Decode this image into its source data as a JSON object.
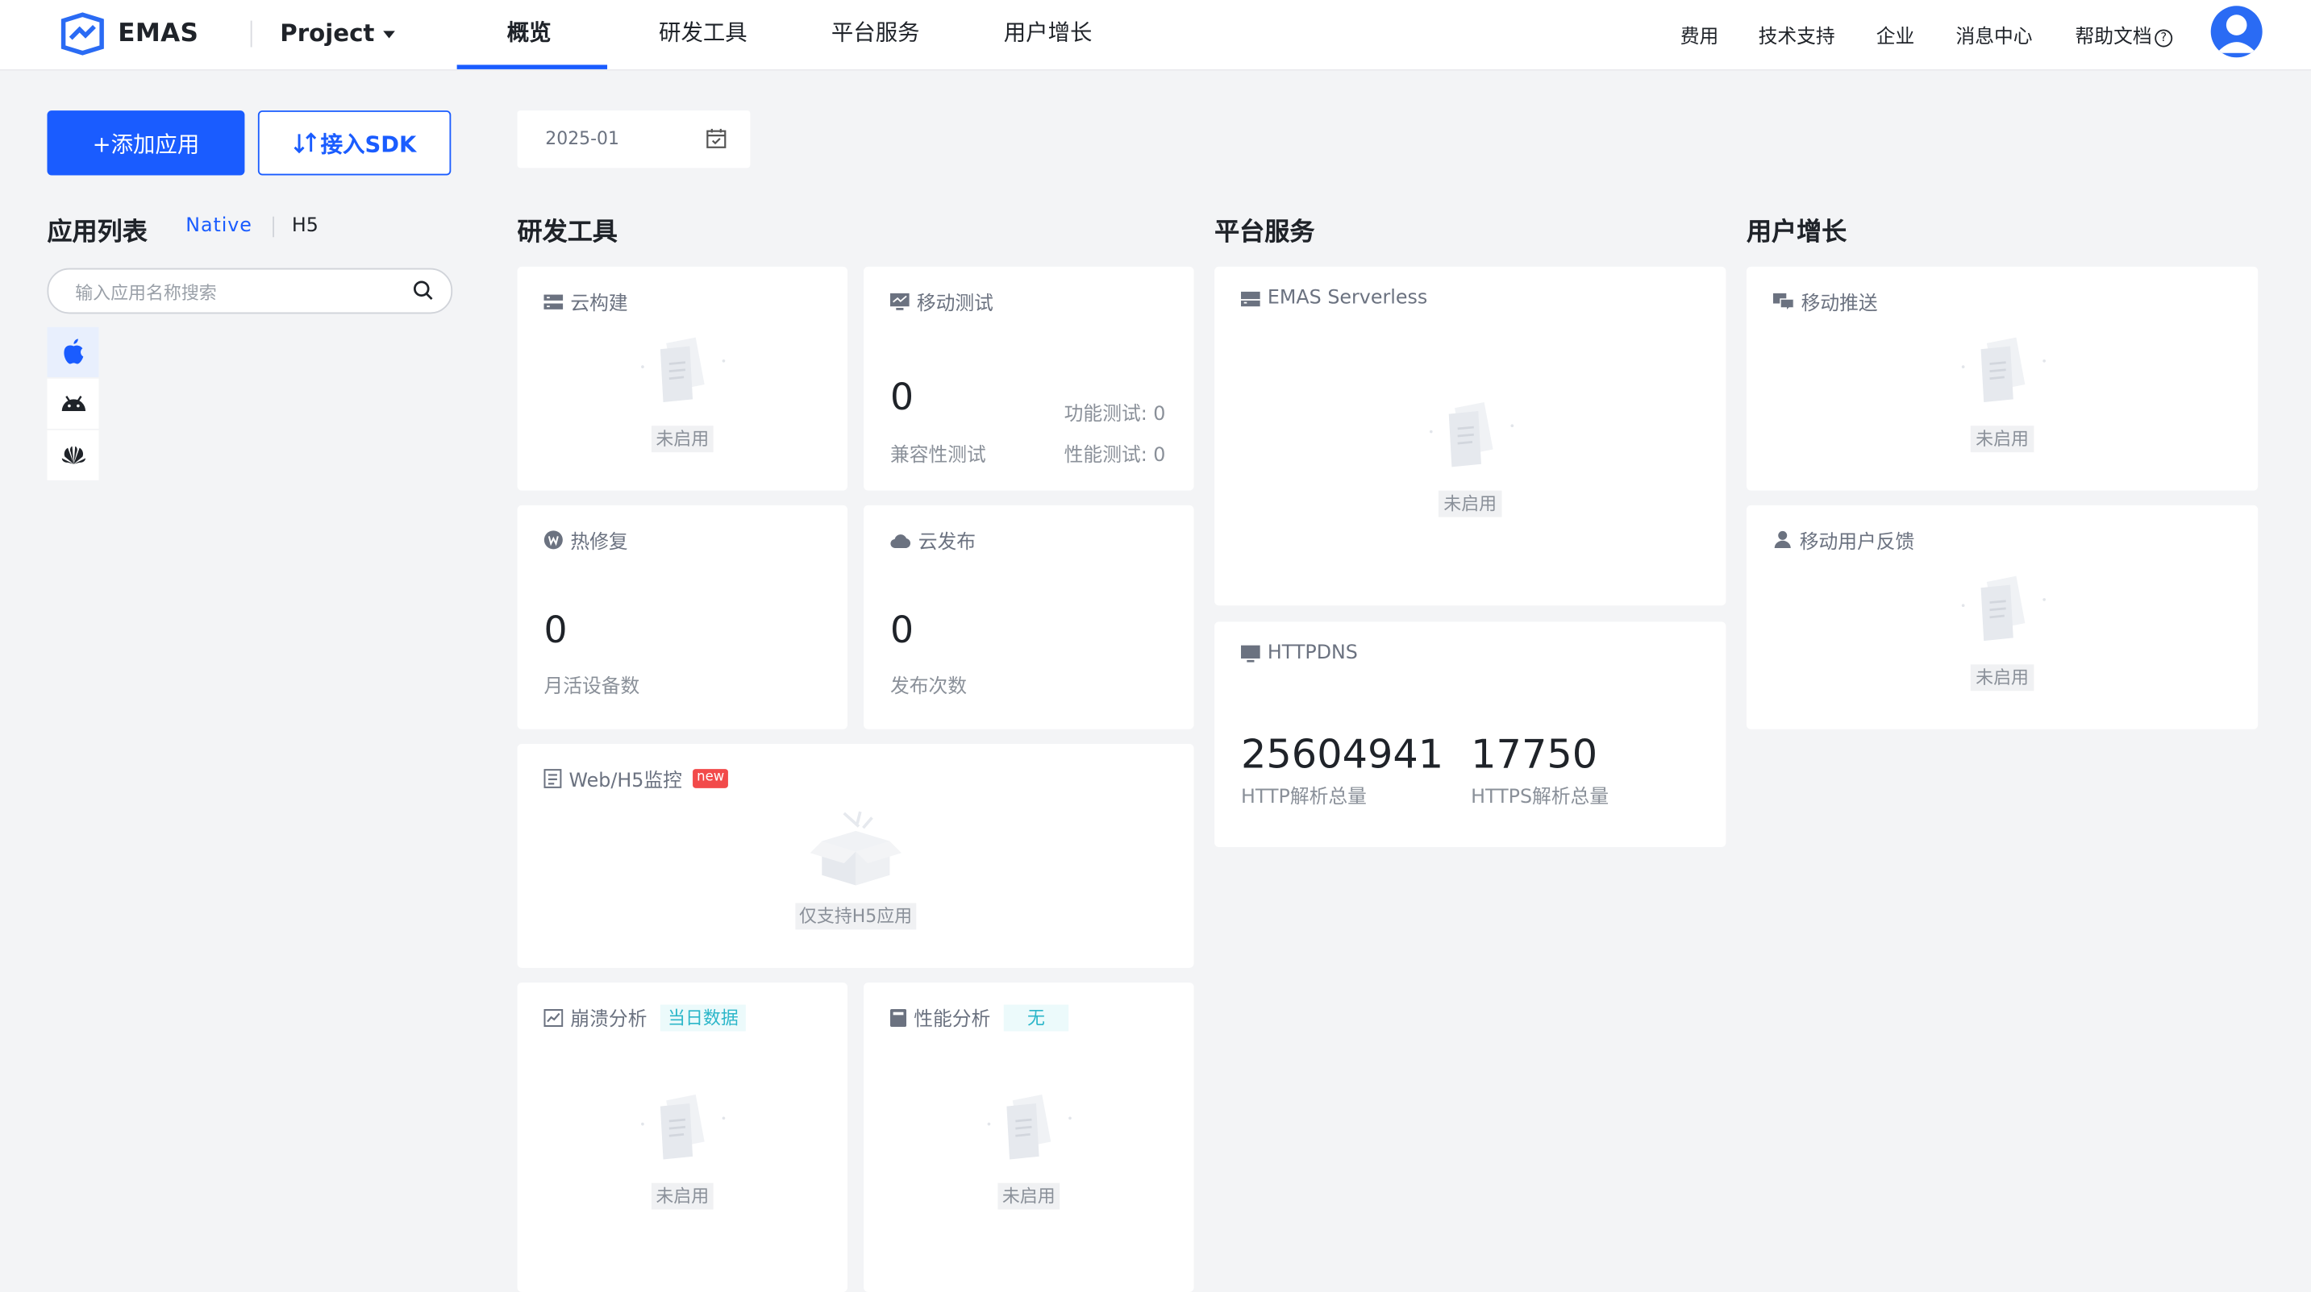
{
  "header": {
    "brand": "EMAS",
    "project_label": "Project",
    "nav_tabs": [
      "概览",
      "研发工具",
      "平台服务",
      "用户增长"
    ],
    "right_links": [
      "费用",
      "技术支持",
      "企业",
      "消息中心",
      "帮助文档"
    ],
    "help_icon": "?"
  },
  "sidebar": {
    "add_app_label": "+添加应用",
    "sdk_label": "接入SDK",
    "list_title": "应用列表",
    "segment_native": "Native",
    "segment_h5": "H5",
    "search_placeholder": "输入应用名称搜索",
    "platforms": [
      "apple-icon",
      "android-icon",
      "huawei-icon"
    ]
  },
  "date_picker": {
    "value": "2025-01"
  },
  "sections": {
    "dev_tools": "研发工具",
    "platform": "平台服务",
    "growth": "用户增长"
  },
  "cards": {
    "cloud_build": {
      "title": "云构建",
      "status": "未启用"
    },
    "mobile_test": {
      "title": "移动测试",
      "value": "0",
      "label": "兼容性测试",
      "func_test": "功能测试: 0",
      "perf_test": "性能测试: 0"
    },
    "hotfix": {
      "title": "热修复",
      "value": "0",
      "label": "月活设备数"
    },
    "cloud_release": {
      "title": "云发布",
      "value": "0",
      "label": "发布次数"
    },
    "web_monitor": {
      "title": "Web/H5监控",
      "badge": "new",
      "status": "仅支持H5应用"
    },
    "crash": {
      "title": "崩溃分析",
      "badge": "当日数据",
      "status": "未启用"
    },
    "perf": {
      "title": "性能分析",
      "badge": "无",
      "status": "未启用"
    },
    "serverless": {
      "title": "EMAS Serverless",
      "status": "未启用"
    },
    "httpdns": {
      "title": "HTTPDNS",
      "http_value": "25604941",
      "http_label": "HTTP解析总量",
      "https_value": "17750",
      "https_label": "HTTPS解析总量"
    },
    "push": {
      "title": "移动推送",
      "status": "未启用"
    },
    "feedback": {
      "title": "移动用户反馈",
      "status": "未启用"
    }
  },
  "colors": {
    "primary": "#1a5cff",
    "teal": "#2bb6c9",
    "badge_red": "#f24a4a"
  }
}
